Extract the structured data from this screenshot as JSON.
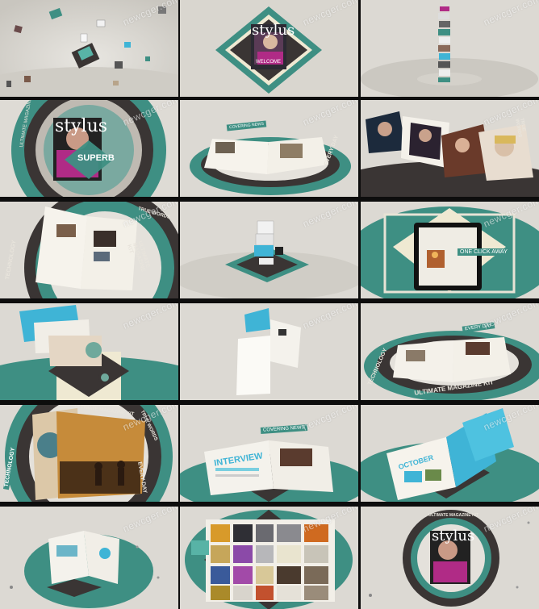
{
  "sheet": {
    "watermark": "newcger.com",
    "brand_title": "stylus",
    "ring_text": "ULTIMATE MAGAZINE KIT",
    "tag_superb": "SUPERB",
    "tag_every_day": "EVERY DAY",
    "tag_technology": "TECHNOLOGY",
    "tag_true_words": "TRUE WORDS",
    "tag_one_click": "ONE CLICK AWAY",
    "tag_interview": "INTERVIEW",
    "tag_covering_news": "COVERING NEWS",
    "tag_welcome": "WELCOME",
    "tag_october": "OCTOBER"
  },
  "colors": {
    "teal": "#3e8f83",
    "teal_light": "#58b3a6",
    "dark": "#3a3534",
    "bg": "#dedbd5",
    "cream": "#efe9d2",
    "magenta": "#b02b86",
    "cyan": "#3fb4d6"
  },
  "frames": [
    {
      "id": 1,
      "scene": "scattered photos"
    },
    {
      "id": 2,
      "scene": "stylus cover diamond"
    },
    {
      "id": 3,
      "scene": "stacked cards column"
    },
    {
      "id": 4,
      "scene": "cover in ring"
    },
    {
      "id": 5,
      "scene": "open magazine on ring"
    },
    {
      "id": 6,
      "scene": "photo strip"
    },
    {
      "id": 7,
      "scene": "magazine close-up ring"
    },
    {
      "id": 8,
      "scene": "small stack on diamond"
    },
    {
      "id": 9,
      "scene": "tablet one click away"
    },
    {
      "id": 10,
      "scene": "falling pages"
    },
    {
      "id": 11,
      "scene": "single floating page"
    },
    {
      "id": 12,
      "scene": "magazine in ring"
    },
    {
      "id": 13,
      "scene": "couple photo spread"
    },
    {
      "id": 14,
      "scene": "interview spread"
    },
    {
      "id": 15,
      "scene": "october spread"
    },
    {
      "id": 16,
      "scene": "small magazine on teal"
    },
    {
      "id": 17,
      "scene": "flower photo grid"
    },
    {
      "id": 18,
      "scene": "final cover in ring"
    }
  ]
}
